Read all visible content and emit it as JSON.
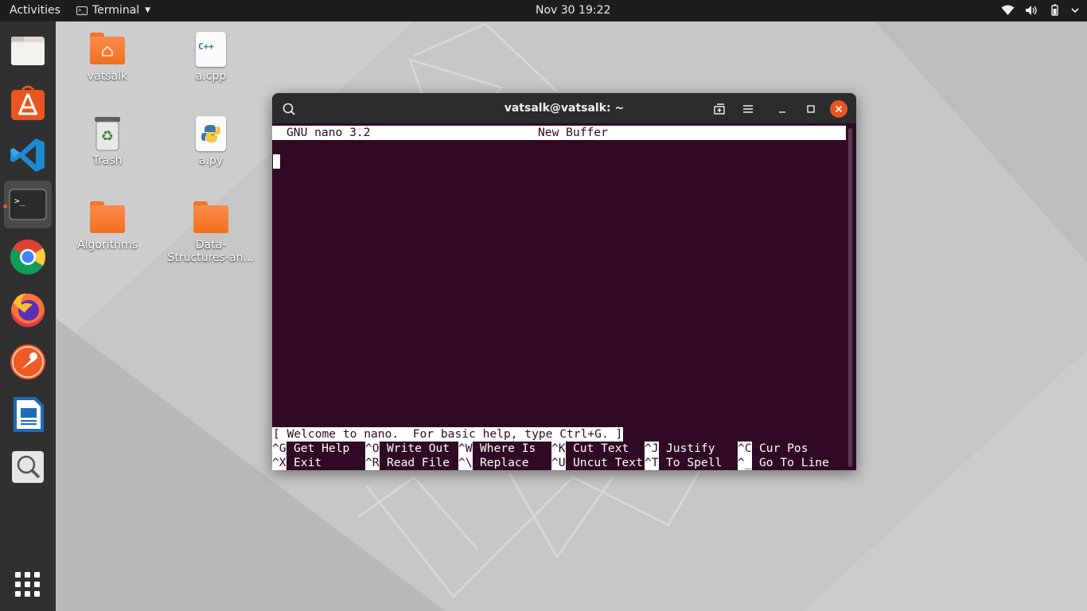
{
  "topbar": {
    "activities": "Activities",
    "app_name": "Terminal",
    "clock": "Nov 30  19:22",
    "tray_icons": [
      "wifi-icon",
      "volume-icon",
      "battery-icon",
      "chevron-down-icon"
    ]
  },
  "dock": {
    "items": [
      {
        "name": "files",
        "icon": "files-icon"
      },
      {
        "name": "software",
        "icon": "software-center-icon"
      },
      {
        "name": "vscode",
        "icon": "vscode-icon"
      },
      {
        "name": "terminal",
        "icon": "terminal-icon",
        "active": true
      },
      {
        "name": "chrome",
        "icon": "chrome-icon"
      },
      {
        "name": "firefox",
        "icon": "firefox-icon"
      },
      {
        "name": "postman",
        "icon": "postman-icon"
      },
      {
        "name": "writer",
        "icon": "libreoffice-writer-icon"
      },
      {
        "name": "image-viewer",
        "icon": "image-viewer-icon"
      },
      {
        "name": "show-apps",
        "icon": "app-grid-icon"
      }
    ]
  },
  "desktop": {
    "icons": [
      {
        "label": "vatsalk",
        "type": "home-folder"
      },
      {
        "label": "a.cpp",
        "type": "cpp-file",
        "badge": "C++"
      },
      {
        "label": "Trash",
        "type": "trash"
      },
      {
        "label": "a.py",
        "type": "python-file"
      },
      {
        "label": "Algorithms",
        "type": "folder"
      },
      {
        "label": "Data-\nStructures-an…",
        "type": "folder"
      }
    ]
  },
  "window": {
    "title": "vatsalk@vatsalk: ~",
    "nano": {
      "version": "GNU nano 3.2",
      "buffer": "New Buffer",
      "status": "[ Welcome to nano.  For basic help, type Ctrl+G. ]",
      "shortcuts_row1": [
        {
          "key": "^G",
          "label": "Get Help"
        },
        {
          "key": "^O",
          "label": "Write Out"
        },
        {
          "key": "^W",
          "label": "Where Is"
        },
        {
          "key": "^K",
          "label": "Cut Text"
        },
        {
          "key": "^J",
          "label": "Justify"
        },
        {
          "key": "^C",
          "label": "Cur Pos"
        }
      ],
      "shortcuts_row2": [
        {
          "key": "^X",
          "label": "Exit"
        },
        {
          "key": "^R",
          "label": "Read File"
        },
        {
          "key": "^\\",
          "label": "Replace"
        },
        {
          "key": "^U",
          "label": "Uncut Text"
        },
        {
          "key": "^T",
          "label": "To Spell"
        },
        {
          "key": "^_",
          "label": "Go To Line"
        }
      ]
    }
  },
  "colors": {
    "accent": "#e95420",
    "terminal_bg": "#300a24",
    "topbar_bg": "#1d1d1d",
    "dock_bg": "#303030"
  }
}
